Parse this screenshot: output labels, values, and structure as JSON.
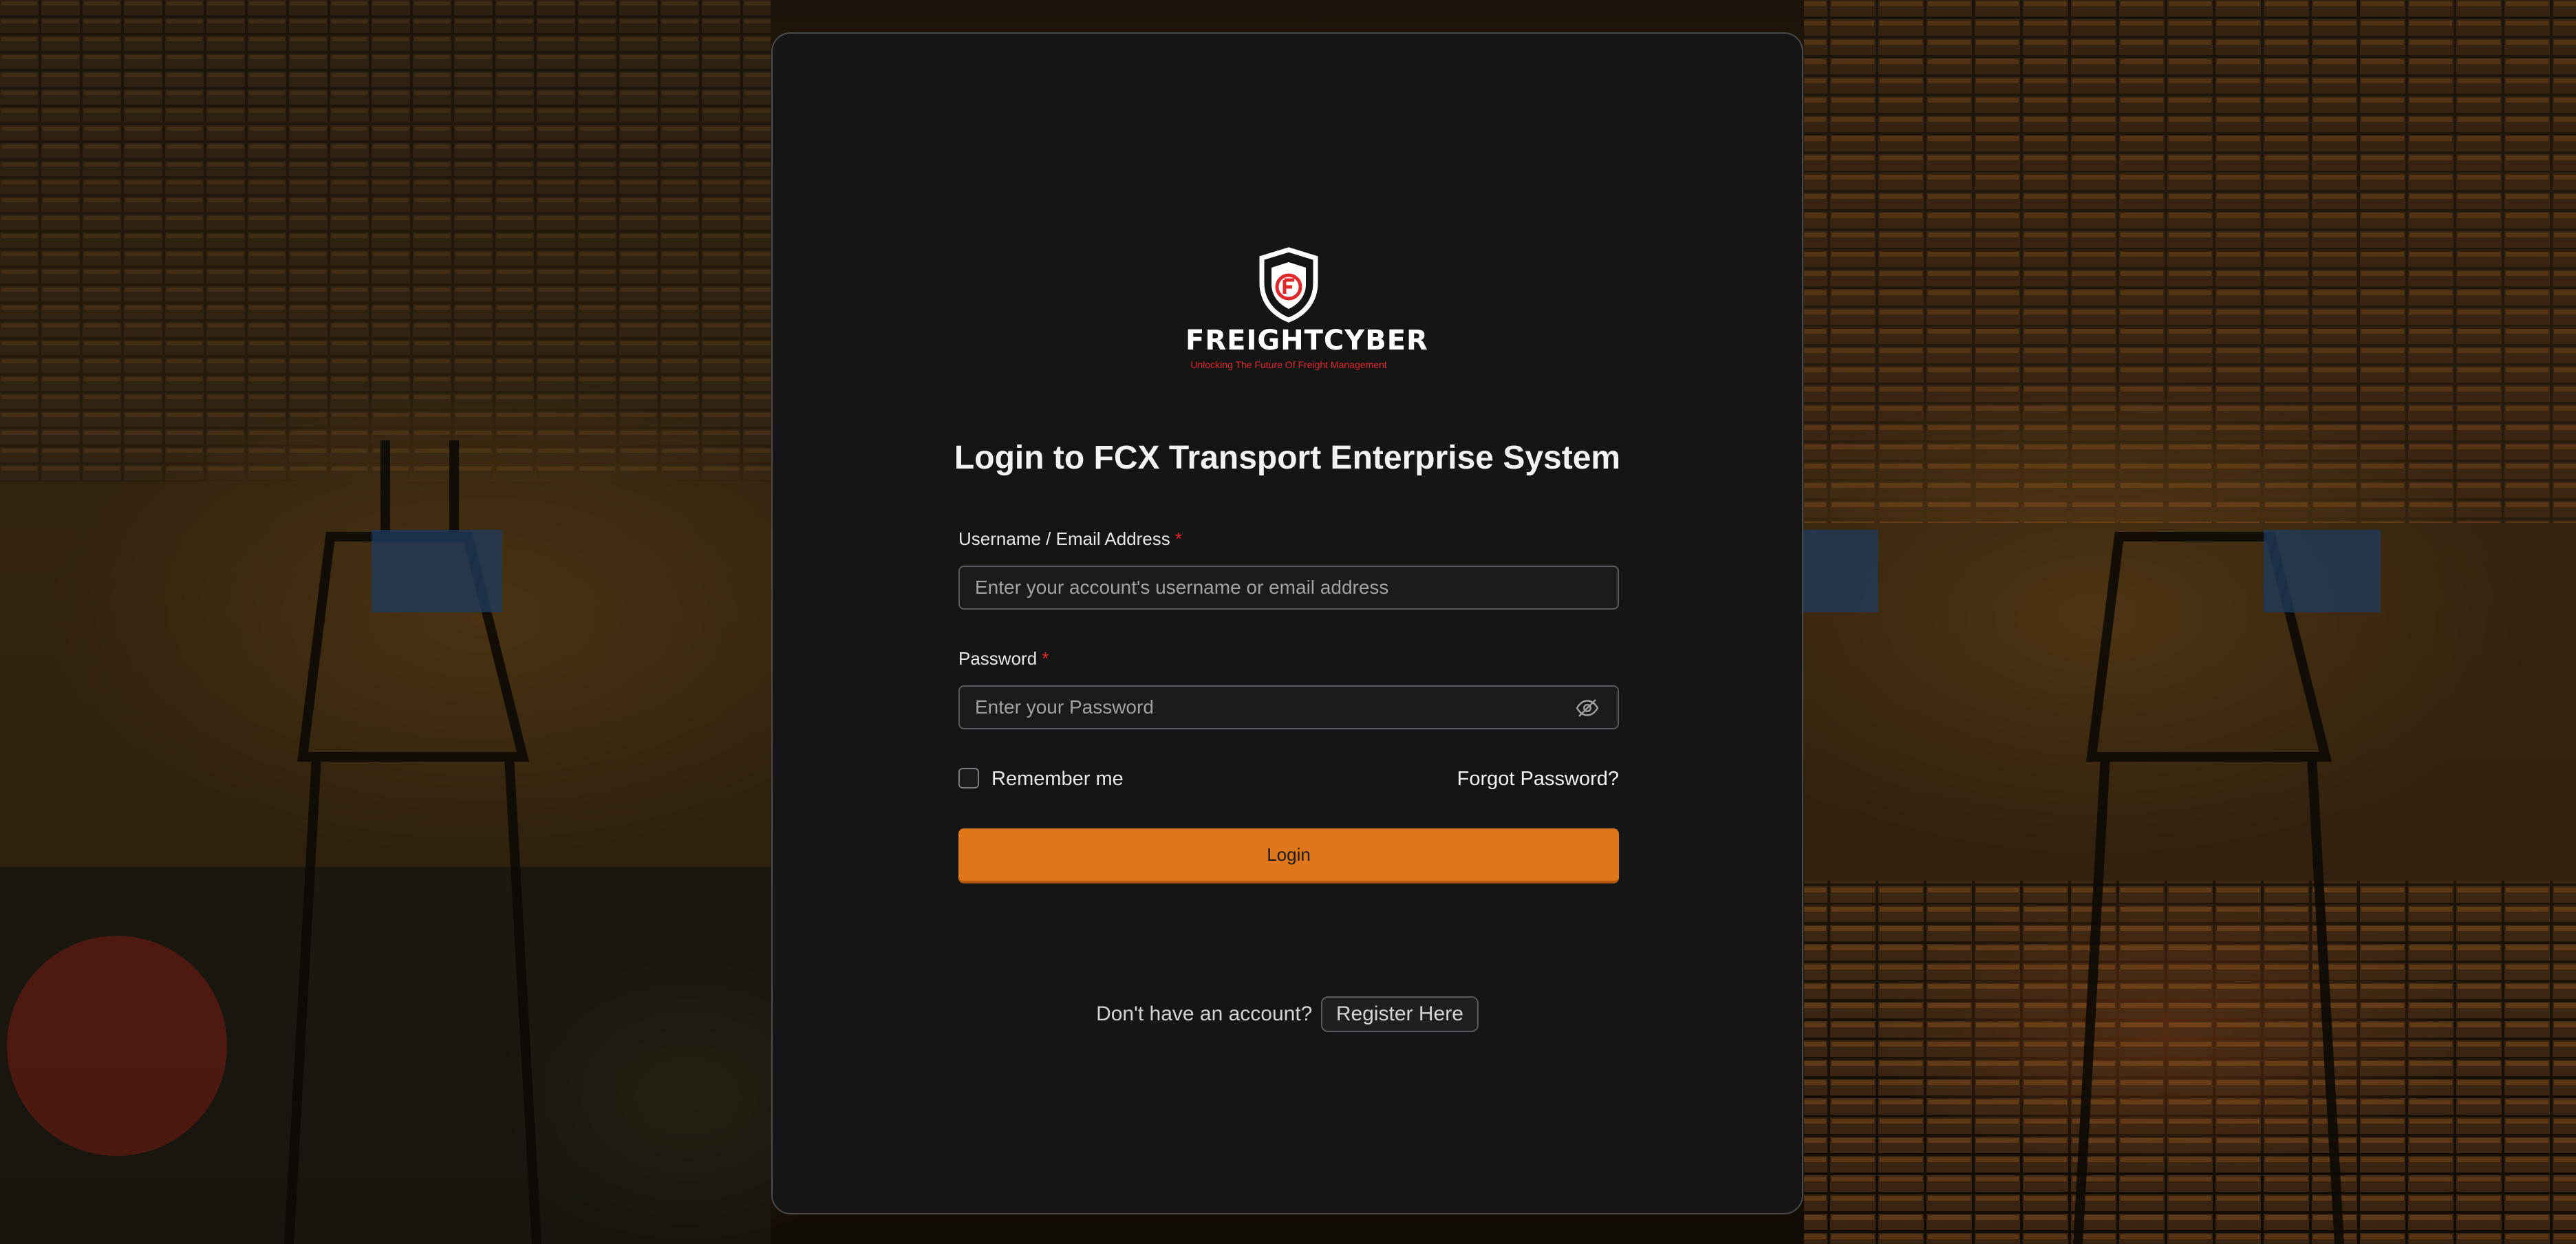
{
  "brand": {
    "logo_text": "FREIGHTCYBER",
    "tagline": "Unlocking The Future Of Freight Management",
    "accent_color": "#e0761a",
    "logo_red": "#e0282b"
  },
  "login": {
    "title": "Login to FCX Transport Enterprise System",
    "username_label": "Username / Email Address",
    "username_placeholder": "Enter your account's username or email address",
    "password_label": "Password",
    "password_placeholder": "Enter your Password",
    "required_marker": "*",
    "remember_label": "Remember me",
    "forgot_label": "Forgot Password?",
    "submit_label": "Login"
  },
  "register": {
    "prompt": "Don't have an account?",
    "link_label": "Register Here"
  },
  "icons": {
    "password_toggle": "eye-slash-icon",
    "logo": "shield-logo-icon"
  }
}
